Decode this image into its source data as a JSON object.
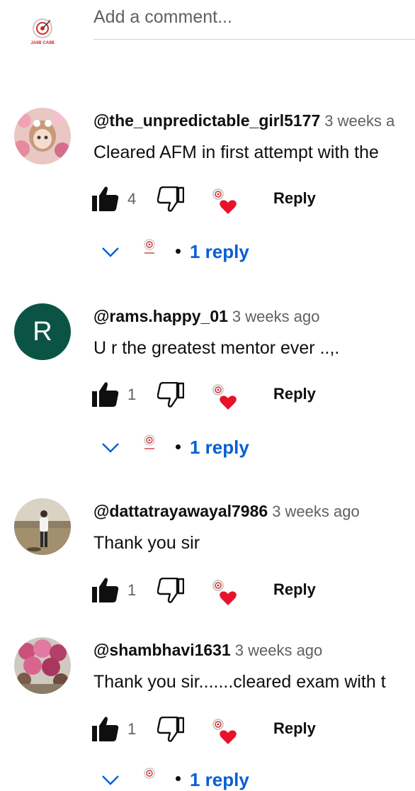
{
  "add_comment": {
    "placeholder": "Add a comment..."
  },
  "channel_logo": {
    "text": "JAIIB CAIIB"
  },
  "comments": [
    {
      "author": "@the_unpredictable_girl5177",
      "time": "3 weeks a",
      "text": "Cleared AFM in first attempt with the",
      "likes": "4",
      "reply_label": "Reply",
      "replies_label": "1 reply"
    },
    {
      "author": "@rams.happy_01",
      "time": "3 weeks ago",
      "avatar_letter": "R",
      "text": "U r the greatest mentor  ever ..,.",
      "likes": "1",
      "reply_label": "Reply",
      "replies_label": "1 reply"
    },
    {
      "author": "@dattatrayawayal7986",
      "time": "3 weeks ago",
      "text": "Thank you sir",
      "likes": "1",
      "reply_label": "Reply"
    },
    {
      "author": "@shambhavi1631",
      "time": "3 weeks ago",
      "text": "Thank you sir.......cleared exam with t",
      "likes": "1",
      "reply_label": "Reply",
      "replies_label": "1 reply"
    }
  ],
  "colors": {
    "link_blue": "#065fd4",
    "heart_red": "#e8132b",
    "avatar_green": "#0b5445",
    "secondary_text": "#606060"
  }
}
